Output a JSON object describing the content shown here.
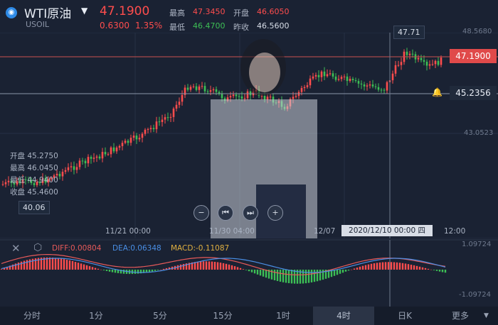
{
  "header": {
    "symbol_name": "WTI原油",
    "symbol_code": "USOIL",
    "price": "47.1900",
    "change": "0.6300",
    "change_pct": "1.35%",
    "high_label": "最高",
    "high": "47.3450",
    "low_label": "最低",
    "low": "46.4700",
    "open_label": "开盘",
    "open": "46.6050",
    "prevclose_label": "昨收",
    "prevclose": "46.5600"
  },
  "chart": {
    "y_ticks": [
      "48.5680",
      "43.0523"
    ],
    "price_tag": "47.1900",
    "alert_price": "45.2356",
    "peak_label": "47.71",
    "low_marker": "40.06",
    "x_ticks": [
      "11/21 00:00",
      "11/30 04:00",
      "12/07",
      "12:00"
    ],
    "crosshair_time": "2020/12/10 00:00 四",
    "ohlc_box": {
      "open_label": "开盘",
      "open": "45.2750",
      "high_label": "最高",
      "high": "46.0450",
      "low_label": "最低",
      "low": "44.9400",
      "close_label": "收盘",
      "close": "45.4600"
    },
    "macd_legend": {
      "diff": "DIFF:0.00804",
      "dea": "DEA:0.06348",
      "macd": "MACD:-0.11087"
    },
    "macd_ticks": [
      "1.09724",
      "-1.09724"
    ],
    "colors": {
      "up": "#ff4d4d",
      "down": "#3dbf55",
      "diff": "#e85a5a",
      "dea": "#4a8fe6"
    }
  },
  "tabs": [
    "分时",
    "1分",
    "5分",
    "15分",
    "1时",
    "4时",
    "日K",
    "更多"
  ],
  "active_tab": "4时"
}
